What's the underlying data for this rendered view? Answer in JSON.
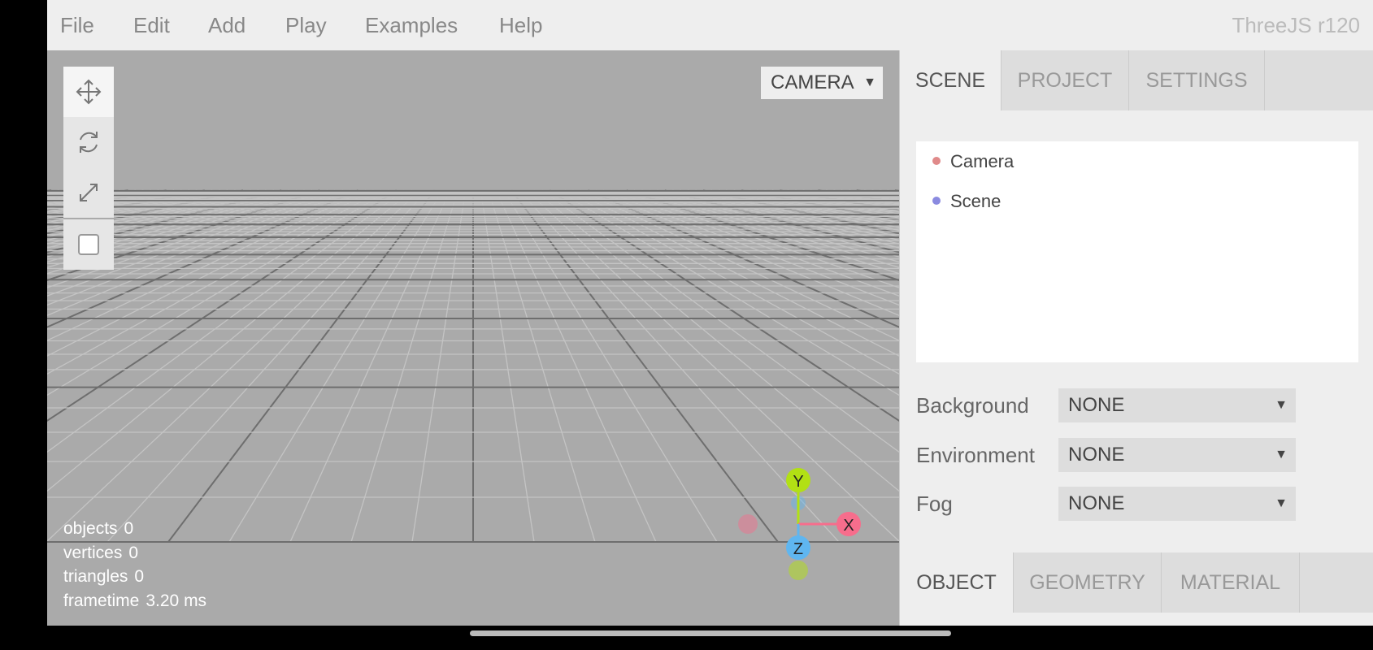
{
  "menubar": {
    "items": [
      "File",
      "Edit",
      "Add",
      "Play",
      "Examples",
      "Help"
    ],
    "version": "ThreeJS r120"
  },
  "viewport": {
    "camera_select": "CAMERA",
    "info": {
      "objects_label": "objects",
      "objects_value": "0",
      "vertices_label": "vertices",
      "vertices_value": "0",
      "triangles_label": "triangles",
      "triangles_value": "0",
      "frametime_label": "frametime",
      "frametime_value": "3.20 ms"
    },
    "toolbar": [
      "move-icon",
      "rotate-icon",
      "scale-icon",
      "checkbox-icon"
    ],
    "gizmo": {
      "x": "X",
      "y": "Y",
      "z": "Z"
    },
    "colors": {
      "x": "#f76d8c",
      "y": "#b2e014",
      "z": "#5fb6f0"
    }
  },
  "sidebar": {
    "tabs": [
      "SCENE",
      "PROJECT",
      "SETTINGS"
    ],
    "outliner": [
      {
        "label": "Camera",
        "color": "#e08a8a"
      },
      {
        "label": "Scene",
        "color": "#8a8ae0"
      }
    ],
    "background": {
      "label": "Background",
      "value": "NONE"
    },
    "environment": {
      "label": "Environment",
      "value": "NONE"
    },
    "fog": {
      "label": "Fog",
      "value": "NONE"
    },
    "bottom_tabs": [
      "OBJECT",
      "GEOMETRY",
      "MATERIAL"
    ]
  }
}
